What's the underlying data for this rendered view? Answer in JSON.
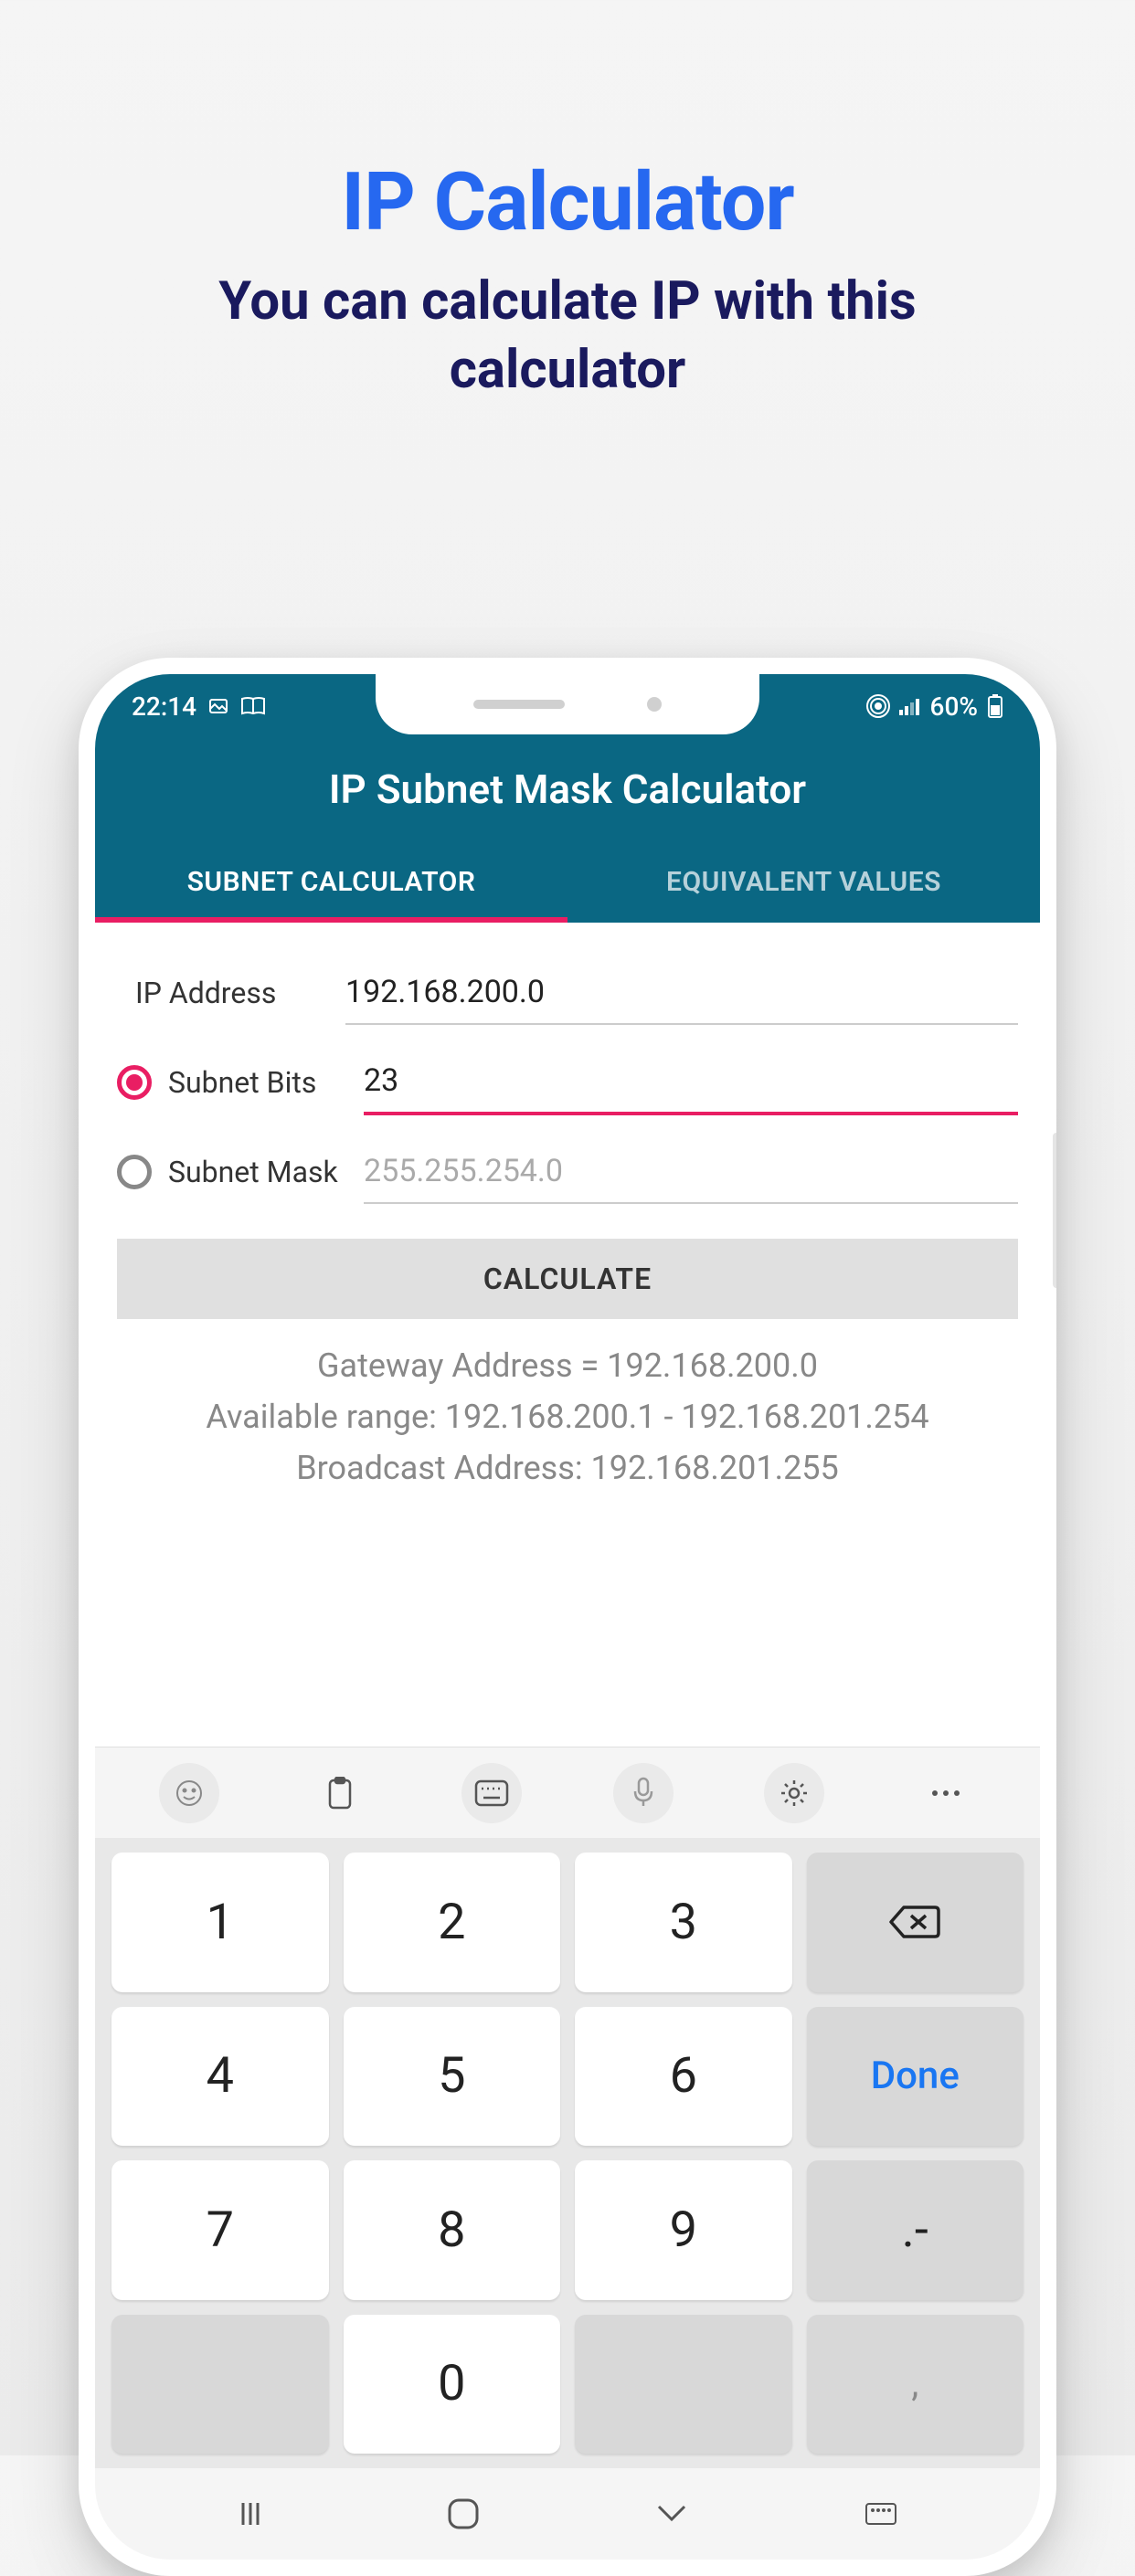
{
  "promo": {
    "title": "IP Calculator",
    "subtitle": "You can calculate IP with this calculator"
  },
  "statusbar": {
    "time": "22:14",
    "battery": "60%"
  },
  "appbar": {
    "title": "IP Subnet Mask Calculator"
  },
  "tabs": {
    "t0": "SUBNET CALCULATOR",
    "t1": "EQUIVALENT VALUES"
  },
  "form": {
    "ip_label": "IP Address",
    "ip_value": "192.168.200.0",
    "bits_label": "Subnet Bits",
    "bits_value": "23",
    "mask_label": "Subnet Mask",
    "mask_placeholder": "255.255.254.0",
    "calculate": "CALCULATE"
  },
  "results": {
    "line1": "Gateway Address = 192.168.200.0",
    "line2": "Available range: 192.168.200.1 - 192.168.201.254",
    "line3": "Broadcast Address: 192.168.201.255"
  },
  "keys": {
    "k1": "1",
    "k2": "2",
    "k3": "3",
    "k4": "4",
    "k5": "5",
    "k6": "6",
    "done": "Done",
    "k7": "7",
    "k8": "8",
    "k9": "9",
    "dot": ".-",
    "k0": "0",
    "comma": ","
  }
}
